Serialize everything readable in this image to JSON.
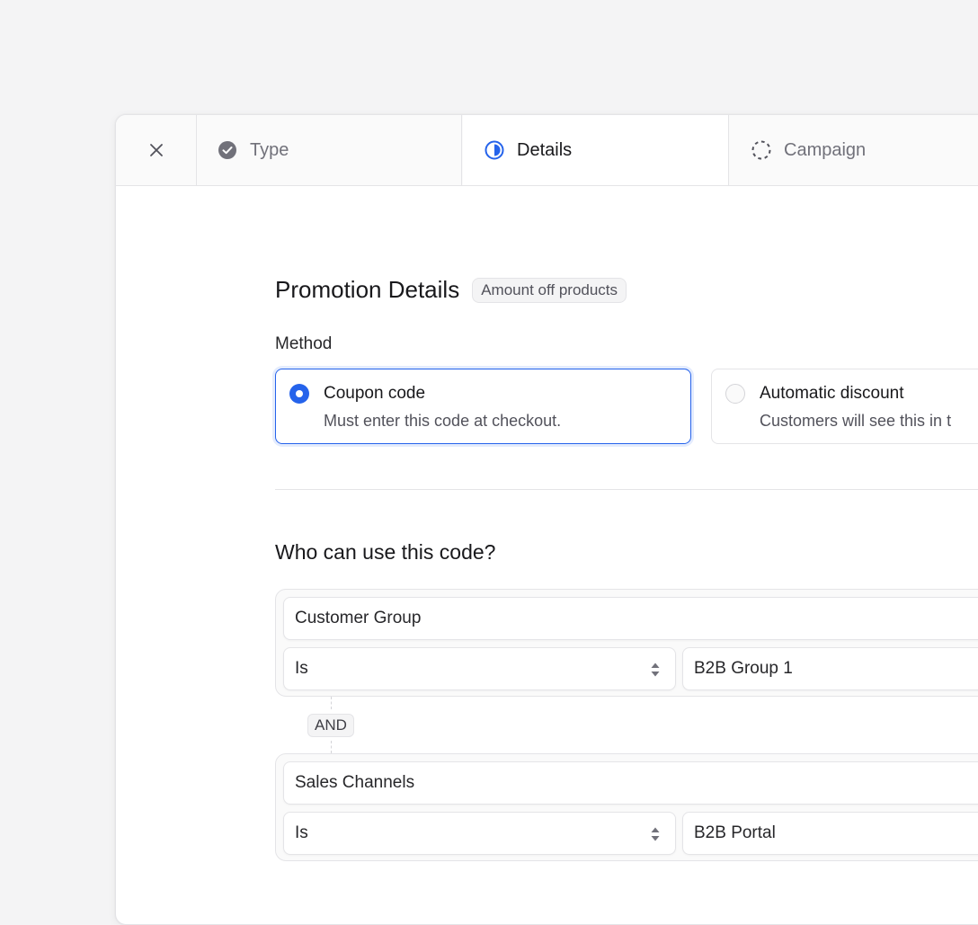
{
  "tabs": {
    "close_label": "Close",
    "items": [
      {
        "label": "Type",
        "status": "completed"
      },
      {
        "label": "Details",
        "status": "in-progress"
      },
      {
        "label": "Campaign",
        "status": "pending"
      }
    ]
  },
  "details": {
    "title": "Promotion Details",
    "badge": "Amount off products",
    "method_label": "Method",
    "methods": [
      {
        "title": "Coupon code",
        "description": "Must enter this code at checkout.",
        "selected": true
      },
      {
        "title": "Automatic discount",
        "description": "Customers will see this in t",
        "selected": false
      }
    ],
    "who_title": "Who can use this code?",
    "conditions": [
      {
        "attribute": "Customer Group",
        "operator": "Is",
        "value": "B2B Group 1"
      },
      {
        "attribute": "Sales Channels",
        "operator": "Is",
        "value": "B2B Portal"
      }
    ],
    "joiner": "AND"
  },
  "colors": {
    "accent": "#2563eb",
    "muted_text": "#71717a",
    "border": "#e4e4e7",
    "icon_gray": "#71717a"
  }
}
